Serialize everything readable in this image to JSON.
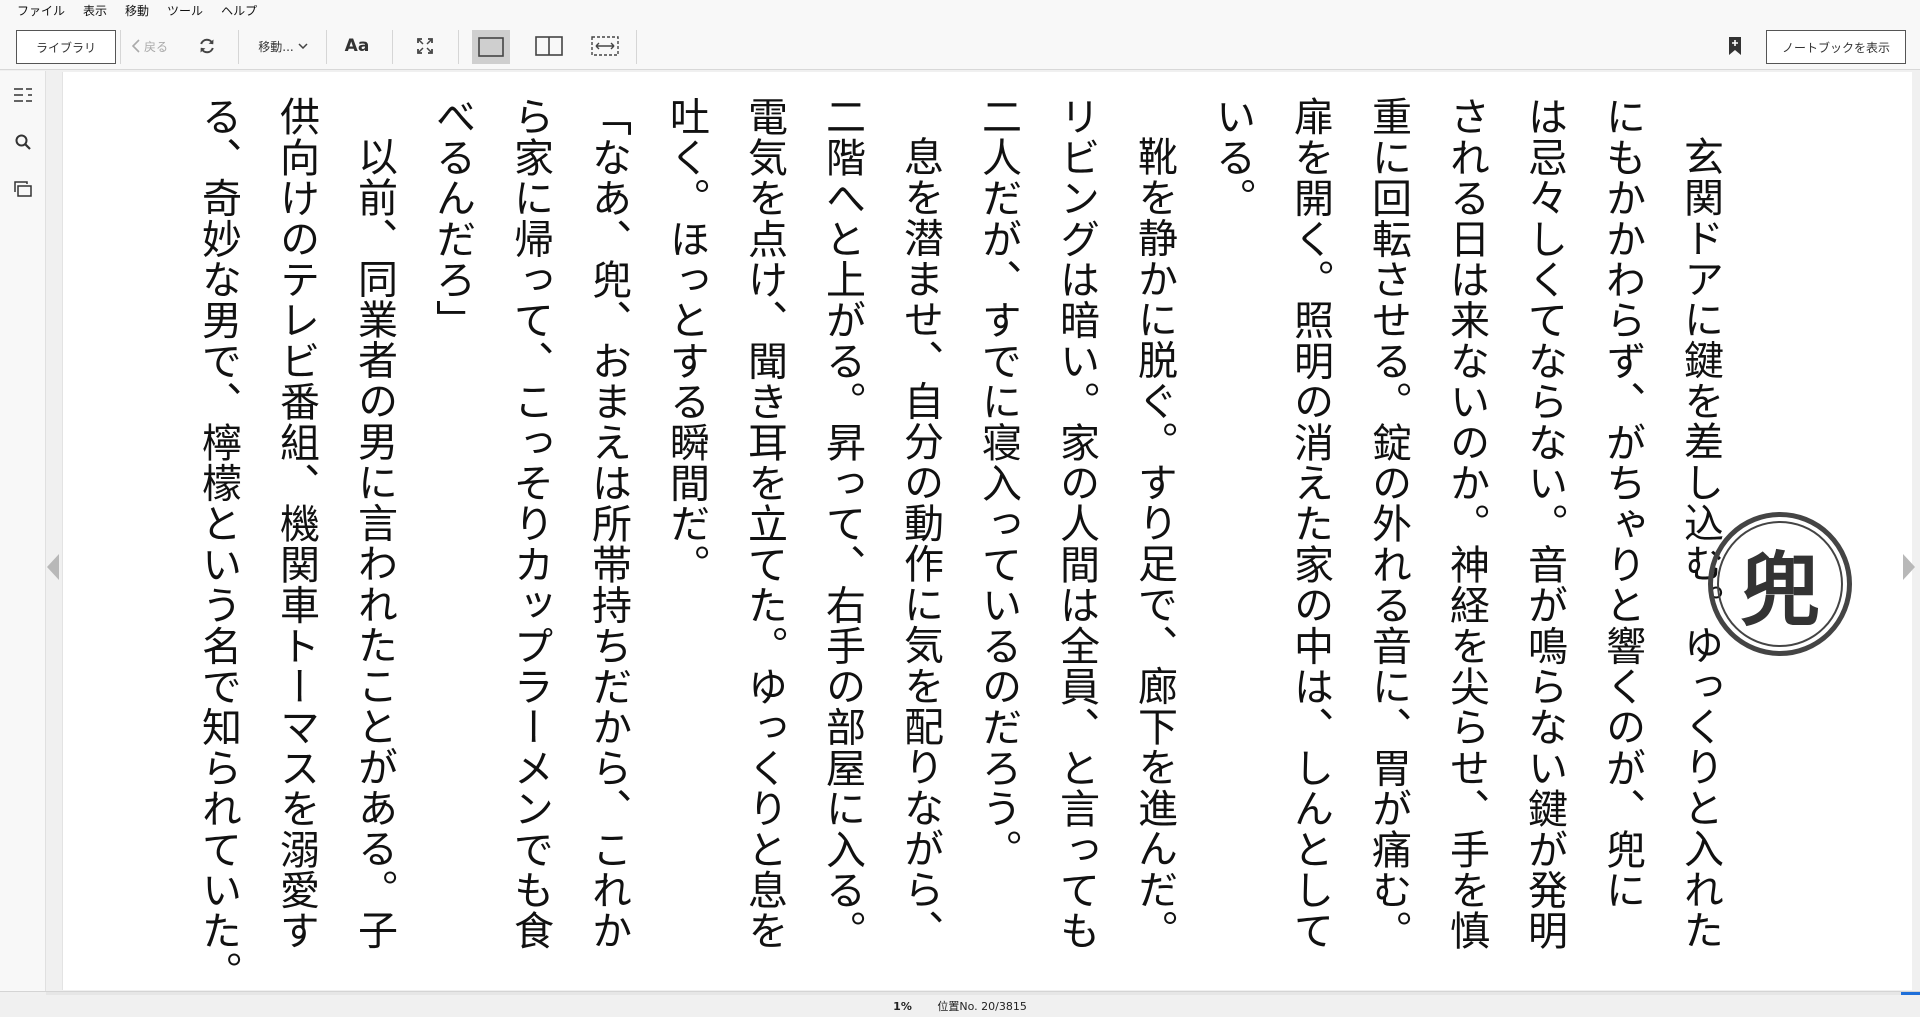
{
  "menu": [
    "ファイル",
    "表示",
    "移動",
    "ツール",
    "ヘルプ"
  ],
  "toolbar": {
    "library_label": "ライブラリ",
    "back_label": "戻る",
    "goto_label": "移動...",
    "font_label": "Aa",
    "notebook_label": "ノートブックを表示"
  },
  "icons": {
    "toc": "table-of-contents-icon",
    "search": "search-icon",
    "cards": "flashcards-icon",
    "refresh": "refresh-icon",
    "bookmark": "bookmark-icon"
  },
  "stamp_glyph": "兜",
  "columns": [
    {
      "text": "玄関ドアに鍵を差し込む。ゆっくりと入れた",
      "indent": true
    },
    {
      "text": "にもかかわらず、がちゃりと響くのが、兜に",
      "indent": false
    },
    {
      "text": "は忌々しくてならない。音が鳴らない鍵が発明",
      "indent": false
    },
    {
      "text": "される日は来ないのか。神経を尖らせ、手を慎",
      "indent": false
    },
    {
      "text": "重に回転させる。錠の外れる音に、胃が痛む。",
      "indent": false
    },
    {
      "text": "扉を開く。照明の消えた家の中は、しんとして",
      "indent": false
    },
    {
      "text": "いる。",
      "indent": false
    },
    {
      "text": "靴を静かに脱ぐ。すり足で、廊下を進んだ。",
      "indent": true
    },
    {
      "text": "リビングは暗い。家の人間は全員、と言っても",
      "indent": false
    },
    {
      "text": "二人だが、すでに寝入っているのだろう。",
      "indent": false
    },
    {
      "text": "息を潜ませ、自分の動作に気を配りながら、",
      "indent": true
    },
    {
      "text": "二階へと上がる。昇って、右手の部屋に入る。",
      "indent": false
    },
    {
      "text": "電気を点け、聞き耳を立てた。ゆっくりと息を",
      "indent": false
    },
    {
      "text": "吐く。ほっとする瞬間だ。",
      "indent": false
    },
    {
      "text": "「なあ、兜、おまえは所帯持ちだから、これか",
      "indent": false
    },
    {
      "text": "ら家に帰って、こっそりカップラーメンでも食",
      "indent": false
    },
    {
      "text": "べるんだろ」",
      "indent": false
    },
    {
      "text": "以前、同業者の男に言われたことがある。子",
      "indent": true
    },
    {
      "text": "供向けのテレビ番組、機関車トーマスを溺愛す",
      "indent": false
    },
    {
      "text": "る、奇妙な男で、檸檬という名で知られていた。",
      "indent": false
    }
  ],
  "status": {
    "percent": "1%",
    "location": "位置No. 20/3815",
    "progress_fraction": 0.01
  }
}
